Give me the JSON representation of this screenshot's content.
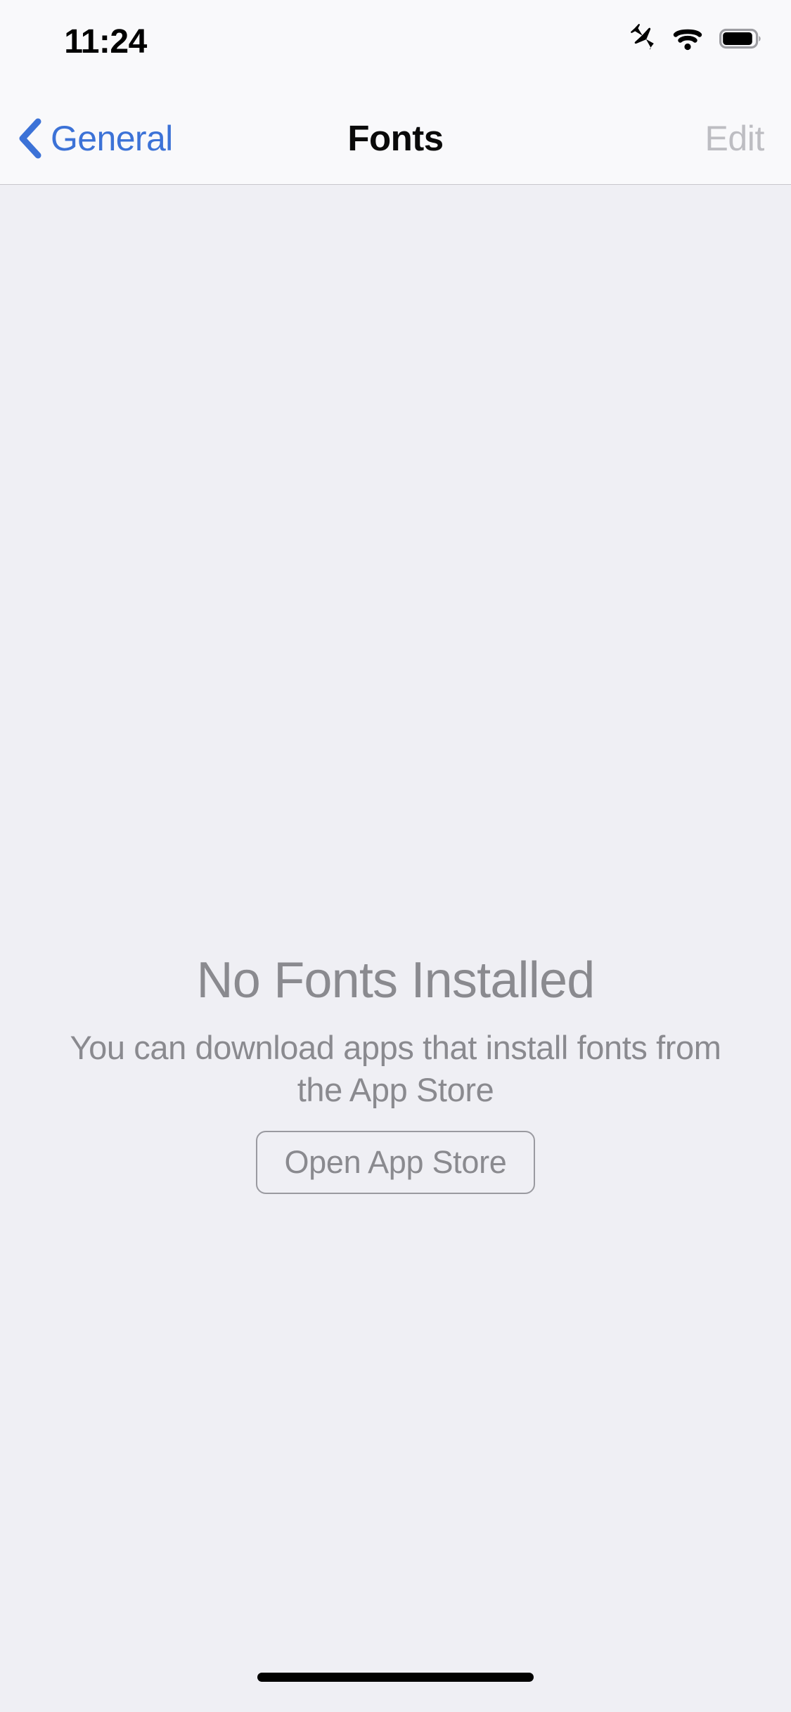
{
  "status_bar": {
    "time": "11:24",
    "icons": [
      {
        "name": "airplane-mode-icon",
        "label": "Airplane Mode"
      },
      {
        "name": "wifi-icon",
        "label": "Wi-Fi"
      },
      {
        "name": "battery-icon",
        "label": "Battery",
        "level_percent": 85
      }
    ]
  },
  "nav_bar": {
    "back_label": "General",
    "back_icon": "chevron-back-icon",
    "title": "Fonts",
    "edit_label": "Edit",
    "edit_enabled": false
  },
  "empty_state": {
    "title": "No Fonts Installed",
    "subtitle": "You can download apps that install fonts from the App Store",
    "button_label": "Open App Store"
  },
  "colors": {
    "accent_blue": "#3C72D7",
    "content_background": "#EFEFF4",
    "bar_background": "#F9F9FB",
    "muted_text": "#8A8A8F",
    "disabled_text": "#BDBDC2",
    "separator": "#C8C7CC"
  }
}
